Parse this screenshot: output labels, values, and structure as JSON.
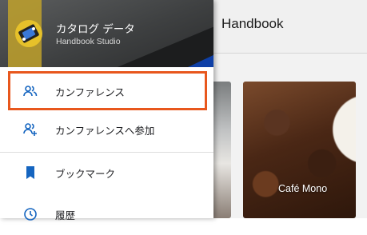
{
  "app": {
    "toolbar_title": "Handbook",
    "cards": [
      {
        "label": ""
      },
      {
        "label": "Café Mono"
      }
    ]
  },
  "drawer": {
    "header": {
      "title": "カタログ データ",
      "subtitle": "Handbook Studio"
    },
    "items": [
      {
        "label": "カンファレンス",
        "icon": "people-icon",
        "selected": true
      },
      {
        "label": "カンファレンスへ参加",
        "icon": "add-people-icon",
        "selected": false
      },
      {
        "label": "ブックマーク",
        "icon": "bookmark-icon",
        "selected": false
      },
      {
        "label": "履歴",
        "icon": "history-icon",
        "selected": false
      }
    ]
  },
  "colors": {
    "accent": "#1565c0",
    "highlight_border": "#e8571d"
  }
}
